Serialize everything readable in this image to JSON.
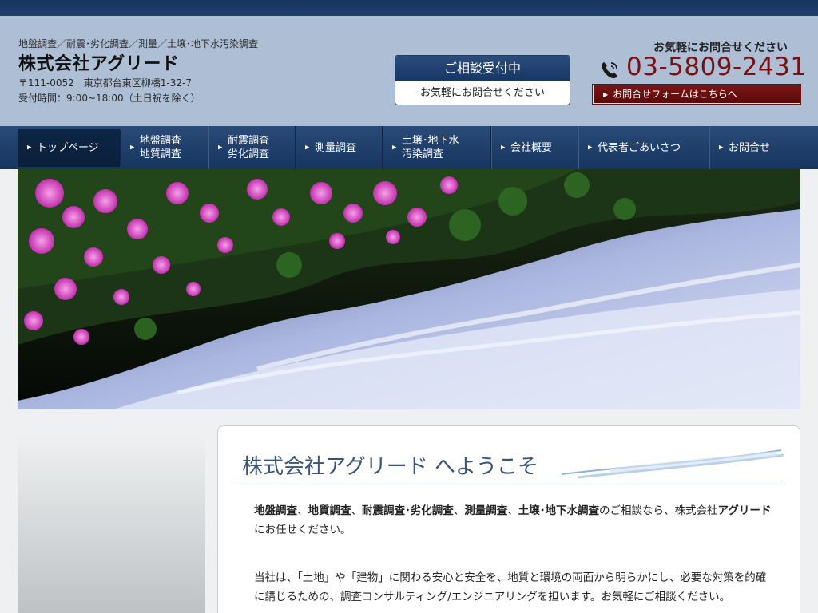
{
  "header": {
    "tagline": "地盤調査／耐震･劣化調査／測量／土壌･地下水汚染調査",
    "company_name": "株式会社アグリード",
    "address": "〒111-0052　東京都台東区柳橋1-32-7",
    "hours": "受付時間：9:00~18:00（土日祝を除く）"
  },
  "consult": {
    "title": "ご相談受付中",
    "subtitle": "お気軽にお問合せください"
  },
  "contact": {
    "note": "お気軽にお問合せください",
    "phone": "03-5809-2431",
    "phone_icon": "phone-icon",
    "form_button": "お問合せフォームはこちらへ"
  },
  "nav": {
    "items": [
      {
        "line1": "トップページ",
        "line2": ""
      },
      {
        "line1": "地盤調査",
        "line2": "地質調査"
      },
      {
        "line1": "耐震調査",
        "line2": "劣化調査"
      },
      {
        "line1": "測量調査",
        "line2": ""
      },
      {
        "line1": "土壌･地下水",
        "line2": "汚染調査"
      },
      {
        "line1": "会社概要",
        "line2": ""
      },
      {
        "line1": "代表者ごあいさつ",
        "line2": ""
      },
      {
        "line1": "お問合せ",
        "line2": ""
      }
    ]
  },
  "main": {
    "welcome_title": "株式会社アグリード へようこそ",
    "para1": {
      "b1": "地盤調査",
      "s1": "、",
      "b2": "地質調査",
      "s2": "、",
      "b3": "耐震調査･劣化調査",
      "s3": "、",
      "b4": "測量調査",
      "s4": "、",
      "b5": "土壌･地下水調査",
      "s5": "のご相談なら、株式会社",
      "b6": "アグリード",
      "s6": "にお任せください。"
    },
    "para2": "当社は、「土地」や「建物」に関わる安心と安全を、地質と環境の両面から明らかにし、必要な対策を的確に講じるための、調査コンサルティング/エンジニアリングを担います。お気軽にご相談ください。"
  },
  "colors": {
    "nav_bg": "#1d3f6c",
    "header_bg": "#aebfd5",
    "phone": "#7a1212",
    "accent_button": "#6e1212"
  }
}
